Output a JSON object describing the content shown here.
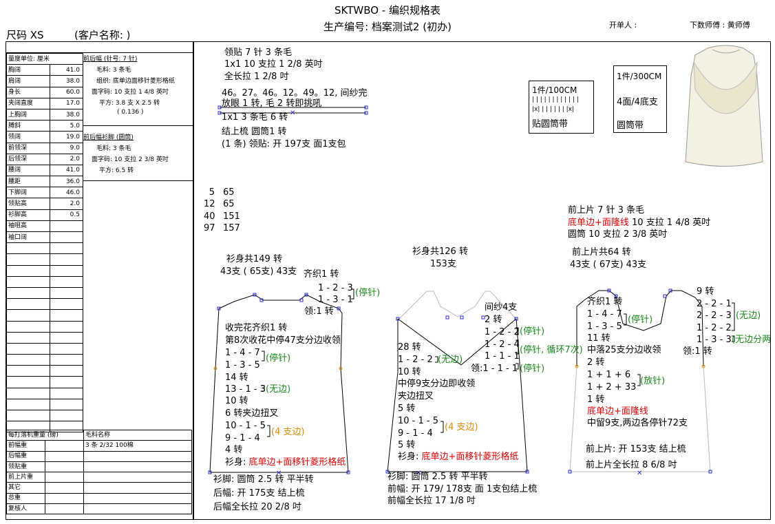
{
  "header": {
    "title": "SKTWBO - 编织规格表",
    "production_no": "生产编号: 档案测试2 (初办)",
    "size": "尺码  XS",
    "customer": "(客户名称: )",
    "issuer": "开单人 :",
    "master": "下数师傅 : 黄师傅"
  },
  "measurements": {
    "unit_label": "量度单位: 厘米",
    "rows": [
      {
        "name": "胸阔",
        "value": "41.0"
      },
      {
        "name": "肩阔",
        "value": "38.0"
      },
      {
        "name": "身长",
        "value": "60.0"
      },
      {
        "name": "夹阔直度",
        "value": "17.0"
      },
      {
        "name": "上胸阔",
        "value": "38.0"
      },
      {
        "name": "膊斜",
        "value": "5.0"
      },
      {
        "name": "领阔",
        "value": "19.0"
      },
      {
        "name": "前领深",
        "value": "9.0"
      },
      {
        "name": "后领深",
        "value": "2.0"
      },
      {
        "name": "腰阔",
        "value": "41.0"
      },
      {
        "name": "腰距",
        "value": "36.0"
      },
      {
        "name": "下脚阔",
        "value": "46.0"
      },
      {
        "name": "领贴高",
        "value": "2.0"
      },
      {
        "name": "衫脚高",
        "value": "0.5"
      },
      {
        "name": "袖咀高",
        "value": ""
      },
      {
        "name": "袖口阔",
        "value": ""
      }
    ]
  },
  "body_specs": {
    "section1_title": "前后幅 (针号: 7 针)",
    "section1_lines": [
      "毛料: 3 条毛",
      "组织: 底单边面移针菱形格纸",
      "面字码: 10 支拉 1 4/8 英吋",
      "平方: 3.8 支 X 2.5 转",
      "( 0.136 )"
    ],
    "section2_title": "前后幅衫脚 (圆筒)",
    "section2_lines": [
      "毛料: 3 条毛",
      "面字码: 10 支拉 2 3/8 英吋",
      "平方: 6.5 转"
    ]
  },
  "weights": {
    "header_left": "每打落机重量 (磅)",
    "header_right": "毛料名称",
    "rows": [
      {
        "name": "前幅重",
        "material": "3 条 2/32 100棉"
      },
      {
        "name": "后幅重",
        "material": ""
      },
      {
        "name": "领贴重",
        "material": ""
      },
      {
        "name": "前上片重",
        "material": ""
      },
      {
        "name": "其它",
        "material": ""
      },
      {
        "name": "总重",
        "material": ""
      },
      {
        "name": "复核人",
        "material": ""
      }
    ]
  },
  "collar": {
    "l1": "领贴  7 针 3 条毛",
    "l2": "1x1   10 支拉 1 2/8 英吋",
    "l3": "全长拉 1 2/8 吋",
    "l4": "46。27。46。12。49。12, 间纱完",
    "l5": "放眼 1 转, 毛 2 转即挑吼",
    "l6": "1x1   3 条毛      6 转",
    "l7": "结上梳  圆筒1 转",
    "l8": "(1 条) 领贴: 开 197支 面1支包"
  },
  "box1": {
    "line1": "1件/100CM",
    "line2": "| | | | | | | | | | | |",
    "line3": "|x| | | | | | | |x|",
    "line4": "贴圆筒带"
  },
  "box2": {
    "line1": "1件/300CM",
    "line2": "4面/4底支",
    "line3": "圆筒带"
  },
  "numbers": [
    {
      "a": "5",
      "b": "65"
    },
    {
      "a": "12",
      "b": "65"
    },
    {
      "a": "40",
      "b": "151"
    },
    {
      "a": "97",
      "b": "157"
    }
  ],
  "back": {
    "total": "衫身共149 转",
    "stitches": "43支 ( 65支) 43支",
    "qizhi": "齐织1 转",
    "n1": "1 - 2 - 3",
    "n2": "1 - 3 - 1",
    "stop": "(停针)",
    "neck": "领:1 转",
    "s1": "收完花齐织1 转",
    "s2": "第8次收花中停47支分边收领",
    "s3": "1 - 4 - 7",
    "s4": "1 - 3 - 5",
    "s4b": "(停针)",
    "s5": "14 转",
    "s6": "13 - 1 - 3",
    "s6b": "(无边)",
    "s7": "10 转",
    "s8": "6 转夹边扭叉",
    "s9": "10 - 1 - 5",
    "s10": "9 - 1 - 4",
    "s10b": "(4 支边)",
    "s11": "4 转",
    "s12a": "衫身: ",
    "s12b": "底单边+面移针菱形格纸",
    "f1": "衫脚: 圆筒  2.5 转  平半转",
    "f2": "后幅: 开 175支 结上梳",
    "f3": "后幅全长拉 20 2/8 吋"
  },
  "front": {
    "total": "衫身共126 转",
    "stitches": "153支",
    "j1": "间纱4支",
    "j2": "2 转",
    "j3": "1 - 2 - 2",
    "j4": "1 - 2 - 4",
    "j5": "1 - 1 - 1",
    "j6": "领:1 - 1 - 1",
    "g1": "(停针)",
    "g2": "(停针, 循环7次)",
    "g3": "(停针)",
    "a1": "28 转",
    "a2": "1 - 2 - 2",
    "a2b": "(无边)",
    "a3": "10 转",
    "a4": "中停9支分边即收领",
    "a5": "夹边扭叉",
    "a6": "5 转",
    "a7": "10 - 1 - 5",
    "a8": "9 - 1 - 4",
    "a8b": "(4 支边)",
    "a9": "5 转",
    "a10a": "衫身: ",
    "a10b": "底单边+面移针菱形格纸",
    "f1": "衫脚: 圆筒  2.5 转  平半转",
    "f2": "前幅: 开 179/ 178支 面 1支包结上梳",
    "f3": "前幅全长拉 17 1/8 吋"
  },
  "upper": {
    "u1": "前上片  7 针 3 条毛",
    "u2a": "底单边+面隆线",
    "u2b": " 10 支拉 1 4/8 英吋",
    "u3": "圆筒 10 支拉 2 3/8 英吋",
    "u4": "前上片共64 转",
    "u5": "43支 ( 67支) 43支",
    "r1": "9 转",
    "r2": "2 - 2 - 1",
    "r3": "2 - 2 - 3",
    "r4": "1 - 2 - 2",
    "r5": "1 - 3 - 3",
    "r6": "(无边)",
    "r7": "(无边分两次收)",
    "q1": "齐织1 转",
    "q2": "1 - 4 - 7",
    "q3": "1 - 3 - 5",
    "q3b": "(停针)",
    "q4": "11 转",
    "q5": "中落25支分边收领",
    "q6": "领:1 转",
    "q7": "2 转",
    "q8": "1 + 1 + 6",
    "q9": "1 + 2 + 33",
    "q9b": "(放针)",
    "q10": "1 转",
    "q11": "底单边+面隆线",
    "q12": "中留9支,两边各停针72支",
    "f1": "前上片: 开 153支 结上梳",
    "f2": "前上片全长拉 8 6/8 吋"
  }
}
